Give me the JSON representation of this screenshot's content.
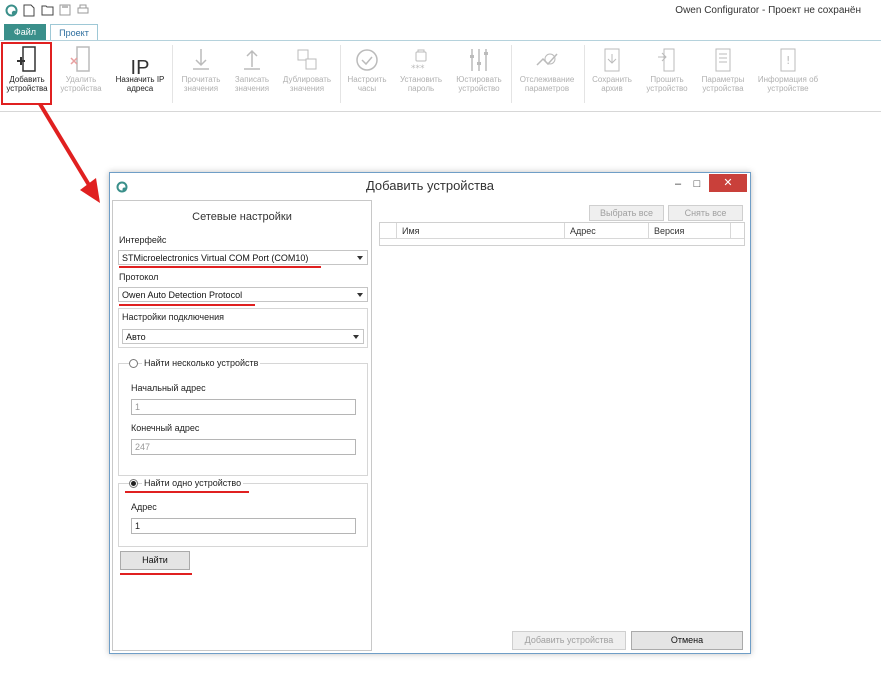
{
  "app": {
    "title": "Owen Configurator - Проект не сохранён"
  },
  "tabs": {
    "file": "Файл",
    "project": "Проект"
  },
  "ribbon": {
    "add_device": [
      "Добавить",
      "устройства"
    ],
    "delete_device": [
      "Удалить",
      "устройства"
    ],
    "assign_ip_icon": "IP",
    "assign_ip": [
      "Назначить IP",
      "адреса"
    ],
    "read_values": [
      "Прочитать",
      "значения"
    ],
    "write_values": [
      "Записать",
      "значения"
    ],
    "duplicate_values": [
      "Дублировать",
      "значения"
    ],
    "set_clock": [
      "Настроить",
      "часы"
    ],
    "set_password": [
      "Установить",
      "пароль"
    ],
    "calibrate_device": [
      "Юстировать",
      "устройство"
    ],
    "monitor_params": [
      "Отслеживание",
      "параметров"
    ],
    "save_archive": [
      "Сохранить",
      "архив"
    ],
    "flash_device": [
      "Прошить",
      "устройство"
    ],
    "device_params": [
      "Параметры",
      "устройства"
    ],
    "device_info": [
      "Информация об",
      "устройстве"
    ]
  },
  "dialog": {
    "title": "Добавить устройства",
    "minimize": "–",
    "maximize": "□",
    "close": "✕",
    "network_settings_title": "Сетевые настройки",
    "interface_label": "Интерфейс",
    "interface_value": "STMicroelectronics Virtual COM Port (COM10)",
    "protocol_label": "Протокол",
    "protocol_value": "Owen Auto Detection Protocol",
    "connection_settings_label": "Настройки подключения",
    "connection_settings_value": "Авто",
    "find_multiple_label": "Найти несколько устройств",
    "start_address_label": "Начальный адрес",
    "start_address_value": "1",
    "end_address_label": "Конечный адрес",
    "end_address_value": "247",
    "find_single_label": "Найти одно устройство",
    "address_label": "Адрес",
    "address_value": "1",
    "find_button": "Найти",
    "select_all_button": "Выбрать все",
    "deselect_all_button": "Снять все",
    "table_headers": [
      "Имя",
      "Адрес",
      "Версия"
    ],
    "add_devices_button": "Добавить устройства",
    "cancel_button": "Отмена"
  },
  "colors": {
    "accent_teal": "#3a8f8a",
    "highlight_red": "#e02020",
    "close_red": "#c9403a"
  }
}
